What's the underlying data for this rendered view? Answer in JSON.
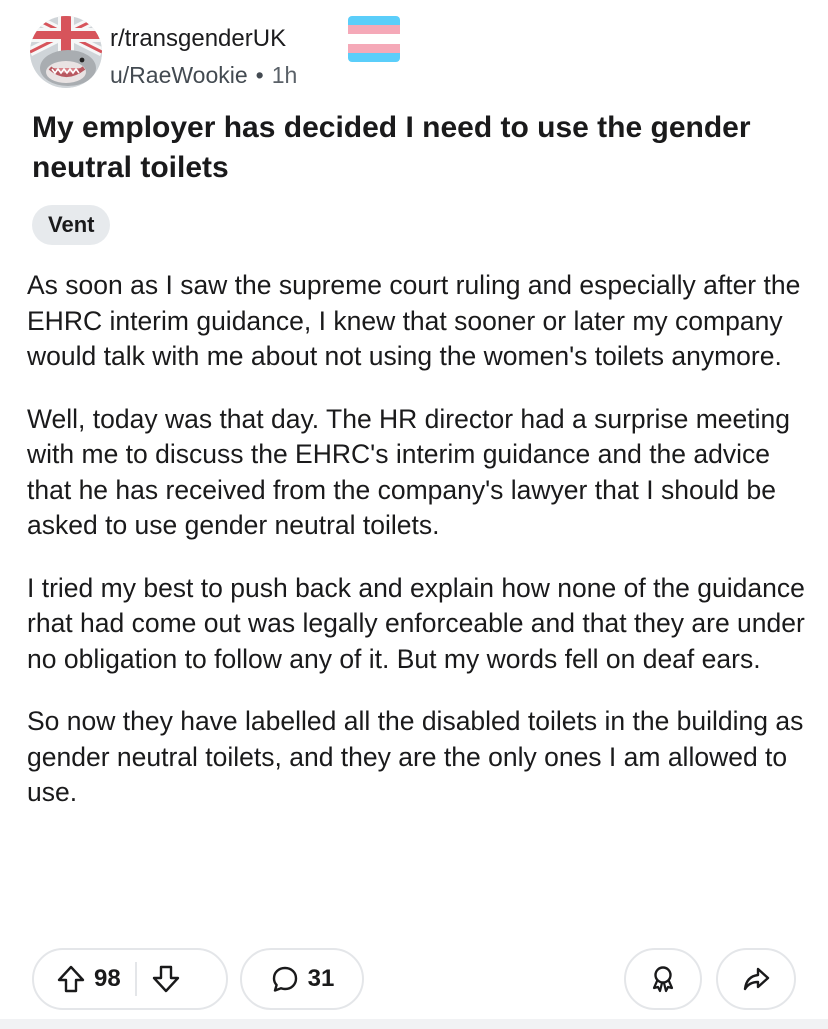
{
  "post": {
    "subreddit": "r/transgenderUK",
    "author": "u/RaeWookie",
    "separator": "•",
    "time": "1h",
    "title": "My employer has decided I need to use the gender neutral toilets",
    "flair": "Vent",
    "paragraphs": [
      "As soon as I saw the supreme court ruling and especially after the EHRC interim guidance, I knew that sooner or later my company would talk with me about not using the women's toilets anymore.",
      "Well, today was that day. The HR director had a surprise meeting with me to discuss the EHRC's interim guidance and the advice that he has received from the company's lawyer that I should be asked to use gender neutral toilets.",
      "I tried my best to push back and explain how none of the guidance rhat had come out was legally enforceable and that they are under no obligation to follow any of it. But my words fell on deaf ears.",
      "So now they have labelled all the disabled toilets in the building as gender neutral toilets, and they are the only ones I am allowed to use."
    ]
  },
  "actions": {
    "upvotes": "98",
    "comments": "31"
  },
  "icons": {
    "avatar": "subreddit-avatar-shark-union-jack",
    "flag": "trans-flag-icon",
    "upvote": "upvote-arrow-icon",
    "downvote": "downvote-arrow-icon",
    "comment": "comment-bubble-icon",
    "award": "award-icon",
    "share": "share-arrow-icon"
  },
  "colors": {
    "trans_blue": "#5bcefa",
    "trans_pink": "#f5a9b8",
    "border": "#e4e6e9",
    "flair_bg": "#e7eaed",
    "text": "#1a1a1b"
  }
}
